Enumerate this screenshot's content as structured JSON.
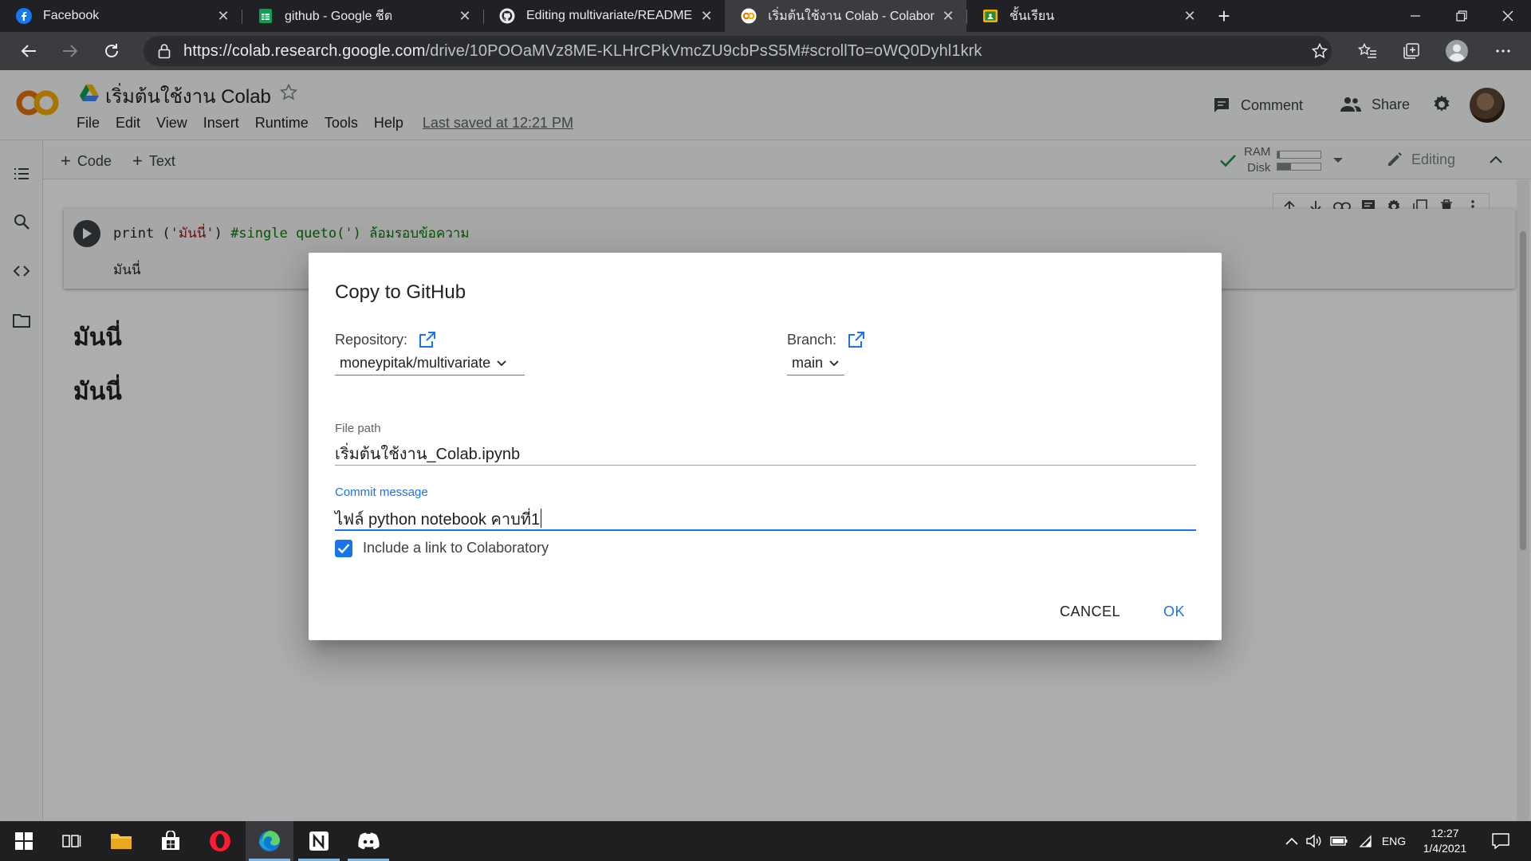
{
  "browser": {
    "tabs": [
      {
        "title": "Facebook",
        "icon": "facebook-icon",
        "active": false
      },
      {
        "title": "github - Google ชีต",
        "icon": "google-sheets-icon",
        "active": false
      },
      {
        "title": "Editing multivariate/README.md",
        "icon": "github-icon",
        "active": false
      },
      {
        "title": "เริ่มต้นใช้งาน Colab - Colaboratory",
        "icon": "colab-icon",
        "active": true
      },
      {
        "title": "ชั้นเรียน",
        "icon": "google-classroom-icon",
        "active": false
      }
    ],
    "url_host": "https://colab.research.google.com",
    "url_path": "/drive/10POOaMVz8ME-KLHrCPkVmcZU9cbPsS5M#scrollTo=oWQ0Dyhl1krk"
  },
  "colab": {
    "logo_text": "CO",
    "title": "เริ่มต้นใช้งาน Colab",
    "menu": [
      "File",
      "Edit",
      "View",
      "Insert",
      "Runtime",
      "Tools",
      "Help"
    ],
    "last_saved": "Last saved at 12:21 PM",
    "comment_label": "Comment",
    "share_label": "Share",
    "toolbar": {
      "add_code": "Code",
      "add_text": "Text",
      "ram_label": "RAM",
      "disk_label": "Disk",
      "ram_usage": 0.05,
      "disk_usage": 0.3,
      "editing_label": "Editing"
    },
    "cell": {
      "code_fn": "print (",
      "code_str": "'มันนี่'",
      "code_close": ") ",
      "code_comment": "#single queto(') ล้อมรอบข้อความ",
      "output": "มันนี่"
    },
    "text_cells": [
      "มันนี่",
      "มันนี่"
    ]
  },
  "dialog": {
    "title": "Copy to GitHub",
    "repository_label": "Repository:",
    "repository_value": "moneypitak/multivariate",
    "branch_label": "Branch:",
    "branch_value": "main",
    "file_path_label": "File path",
    "file_path_value": "เริ่มต้นใช้งาน_Colab.ipynb",
    "commit_label": "Commit message",
    "commit_value": "ไฟล์ python notebook คาบที่1",
    "include_link_label": "Include a link to Colaboratory",
    "include_link_checked": true,
    "cancel_label": "CANCEL",
    "ok_label": "OK"
  },
  "taskbar": {
    "language": "ENG",
    "time": "12:27",
    "date": "1/4/2021"
  },
  "colors": {
    "accent_blue": "#1a73e8",
    "colab_orange": "#f9ab00",
    "browser_dark": "#202124"
  }
}
